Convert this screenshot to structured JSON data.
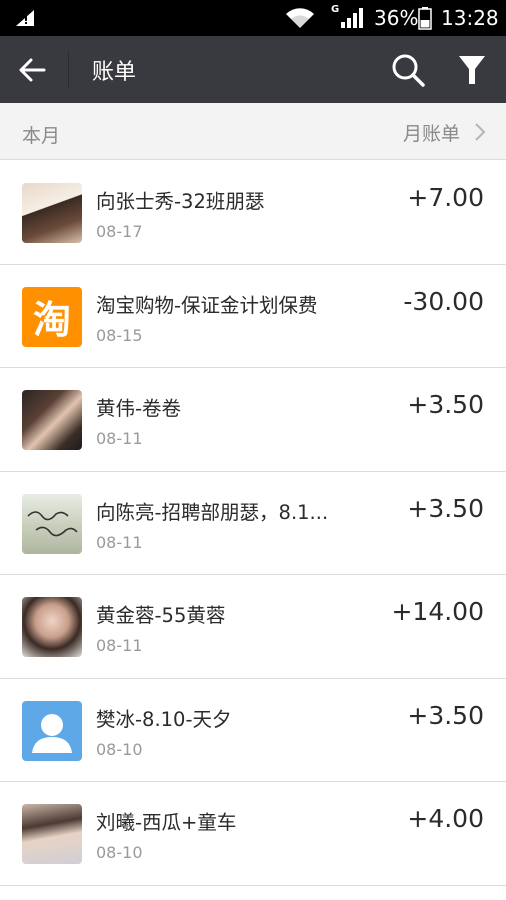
{
  "status_bar": {
    "network_type": "G",
    "battery": "36%",
    "time": "13:28"
  },
  "header": {
    "title": "账单",
    "back_icon": "back-arrow-icon",
    "search_icon": "search-icon",
    "filter_icon": "filter-icon"
  },
  "month_section": {
    "label": "本月",
    "link_label": "月账单"
  },
  "transactions": [
    {
      "title": "向张士秀-32班朋瑟",
      "date": "08-17",
      "amount": "+7.00",
      "avatar": "photo"
    },
    {
      "title": "淘宝购物-保证金计划保费",
      "date": "08-15",
      "amount": "-30.00",
      "avatar": "taobao-logo",
      "logo_text": "淘",
      "logo_color": "#ff9000"
    },
    {
      "title": "黄伟-卷卷",
      "date": "08-11",
      "amount": "+3.50",
      "avatar": "photo"
    },
    {
      "title": "向陈亮-招聘部朋瑟，8.1...",
      "date": "08-11",
      "amount": "+3.50",
      "avatar": "photo"
    },
    {
      "title": "黄金蓉-55黄蓉",
      "date": "08-11",
      "amount": "+14.00",
      "avatar": "photo"
    },
    {
      "title": "樊冰-8.10-天夕",
      "date": "08-10",
      "amount": "+3.50",
      "avatar": "default-user",
      "avatar_color": "#5fa8e8"
    },
    {
      "title": "刘曦-西瓜+童车",
      "date": "08-10",
      "amount": "+4.00",
      "avatar": "photo"
    }
  ],
  "colors": {
    "titlebar": "#393a3f",
    "status_bar": "#000000",
    "section_bg": "#f3f3f3"
  }
}
